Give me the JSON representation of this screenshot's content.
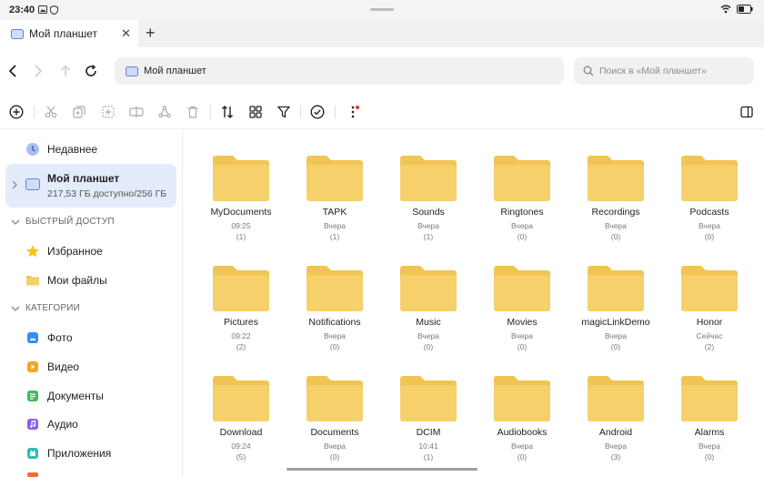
{
  "status": {
    "time": "23:40"
  },
  "tab": {
    "title": "Мой планшет"
  },
  "address": {
    "path": "Мой планшет"
  },
  "search": {
    "placeholder": "Поиск в «Мой планшет»"
  },
  "sidebar": {
    "recent": "Недавнее",
    "device": {
      "label": "Мой планшет",
      "storage": "217,53 ГБ доступно/256 ГБ"
    },
    "quick_access_title": "БЫСТРЫЙ ДОСТУП",
    "quick_access": [
      {
        "label": "Избранное",
        "icon": "star-icon",
        "color": "#f5c518"
      },
      {
        "label": "Мои файлы",
        "icon": "folder-icon",
        "color": "#f6c84c"
      }
    ],
    "categories_title": "КАТЕГОРИИ",
    "categories": [
      {
        "label": "Фото",
        "icon": "photo-icon",
        "color": "#2f8ef5"
      },
      {
        "label": "Видео",
        "icon": "video-icon",
        "color": "#f5a623"
      },
      {
        "label": "Документы",
        "icon": "document-icon",
        "color": "#3dbb5c"
      },
      {
        "label": "Аудио",
        "icon": "audio-icon",
        "color": "#8a5cf6"
      },
      {
        "label": "Приложения",
        "icon": "apps-icon",
        "color": "#2bbfb3"
      }
    ]
  },
  "folders": [
    {
      "name": "MyDocuments",
      "date": "09:25",
      "count": "(1)"
    },
    {
      "name": "TAPK",
      "date": "Вчера",
      "count": "(1)"
    },
    {
      "name": "Sounds",
      "date": "Вчера",
      "count": "(1)"
    },
    {
      "name": "Ringtones",
      "date": "Вчера",
      "count": "(0)"
    },
    {
      "name": "Recordings",
      "date": "Вчера",
      "count": "(0)"
    },
    {
      "name": "Podcasts",
      "date": "Вчера",
      "count": "(0)"
    },
    {
      "name": "Pictures",
      "date": "09:22",
      "count": "(2)"
    },
    {
      "name": "Notifications",
      "date": "Вчера",
      "count": "(0)"
    },
    {
      "name": "Music",
      "date": "Вчера",
      "count": "(0)"
    },
    {
      "name": "Movies",
      "date": "Вчера",
      "count": "(0)"
    },
    {
      "name": "magicLinkDemo",
      "date": "Вчера",
      "count": "(0)"
    },
    {
      "name": "Honor",
      "date": "Сейчас",
      "count": "(2)"
    },
    {
      "name": "Download",
      "date": "09:24",
      "count": "(5)"
    },
    {
      "name": "Documents",
      "date": "Вчера",
      "count": "(0)"
    },
    {
      "name": "DCIM",
      "date": "10:41",
      "count": "(1)"
    },
    {
      "name": "Audiobooks",
      "date": "Вчера",
      "count": "(0)"
    },
    {
      "name": "Android",
      "date": "Вчера",
      "count": "(3)"
    },
    {
      "name": "Alarms",
      "date": "Вчера",
      "count": "(0)"
    }
  ],
  "colors": {
    "folder": "#f6d06a",
    "folder_back": "#f1c553",
    "selection": "#e4ebfb",
    "accent": "#2f6fe0"
  }
}
